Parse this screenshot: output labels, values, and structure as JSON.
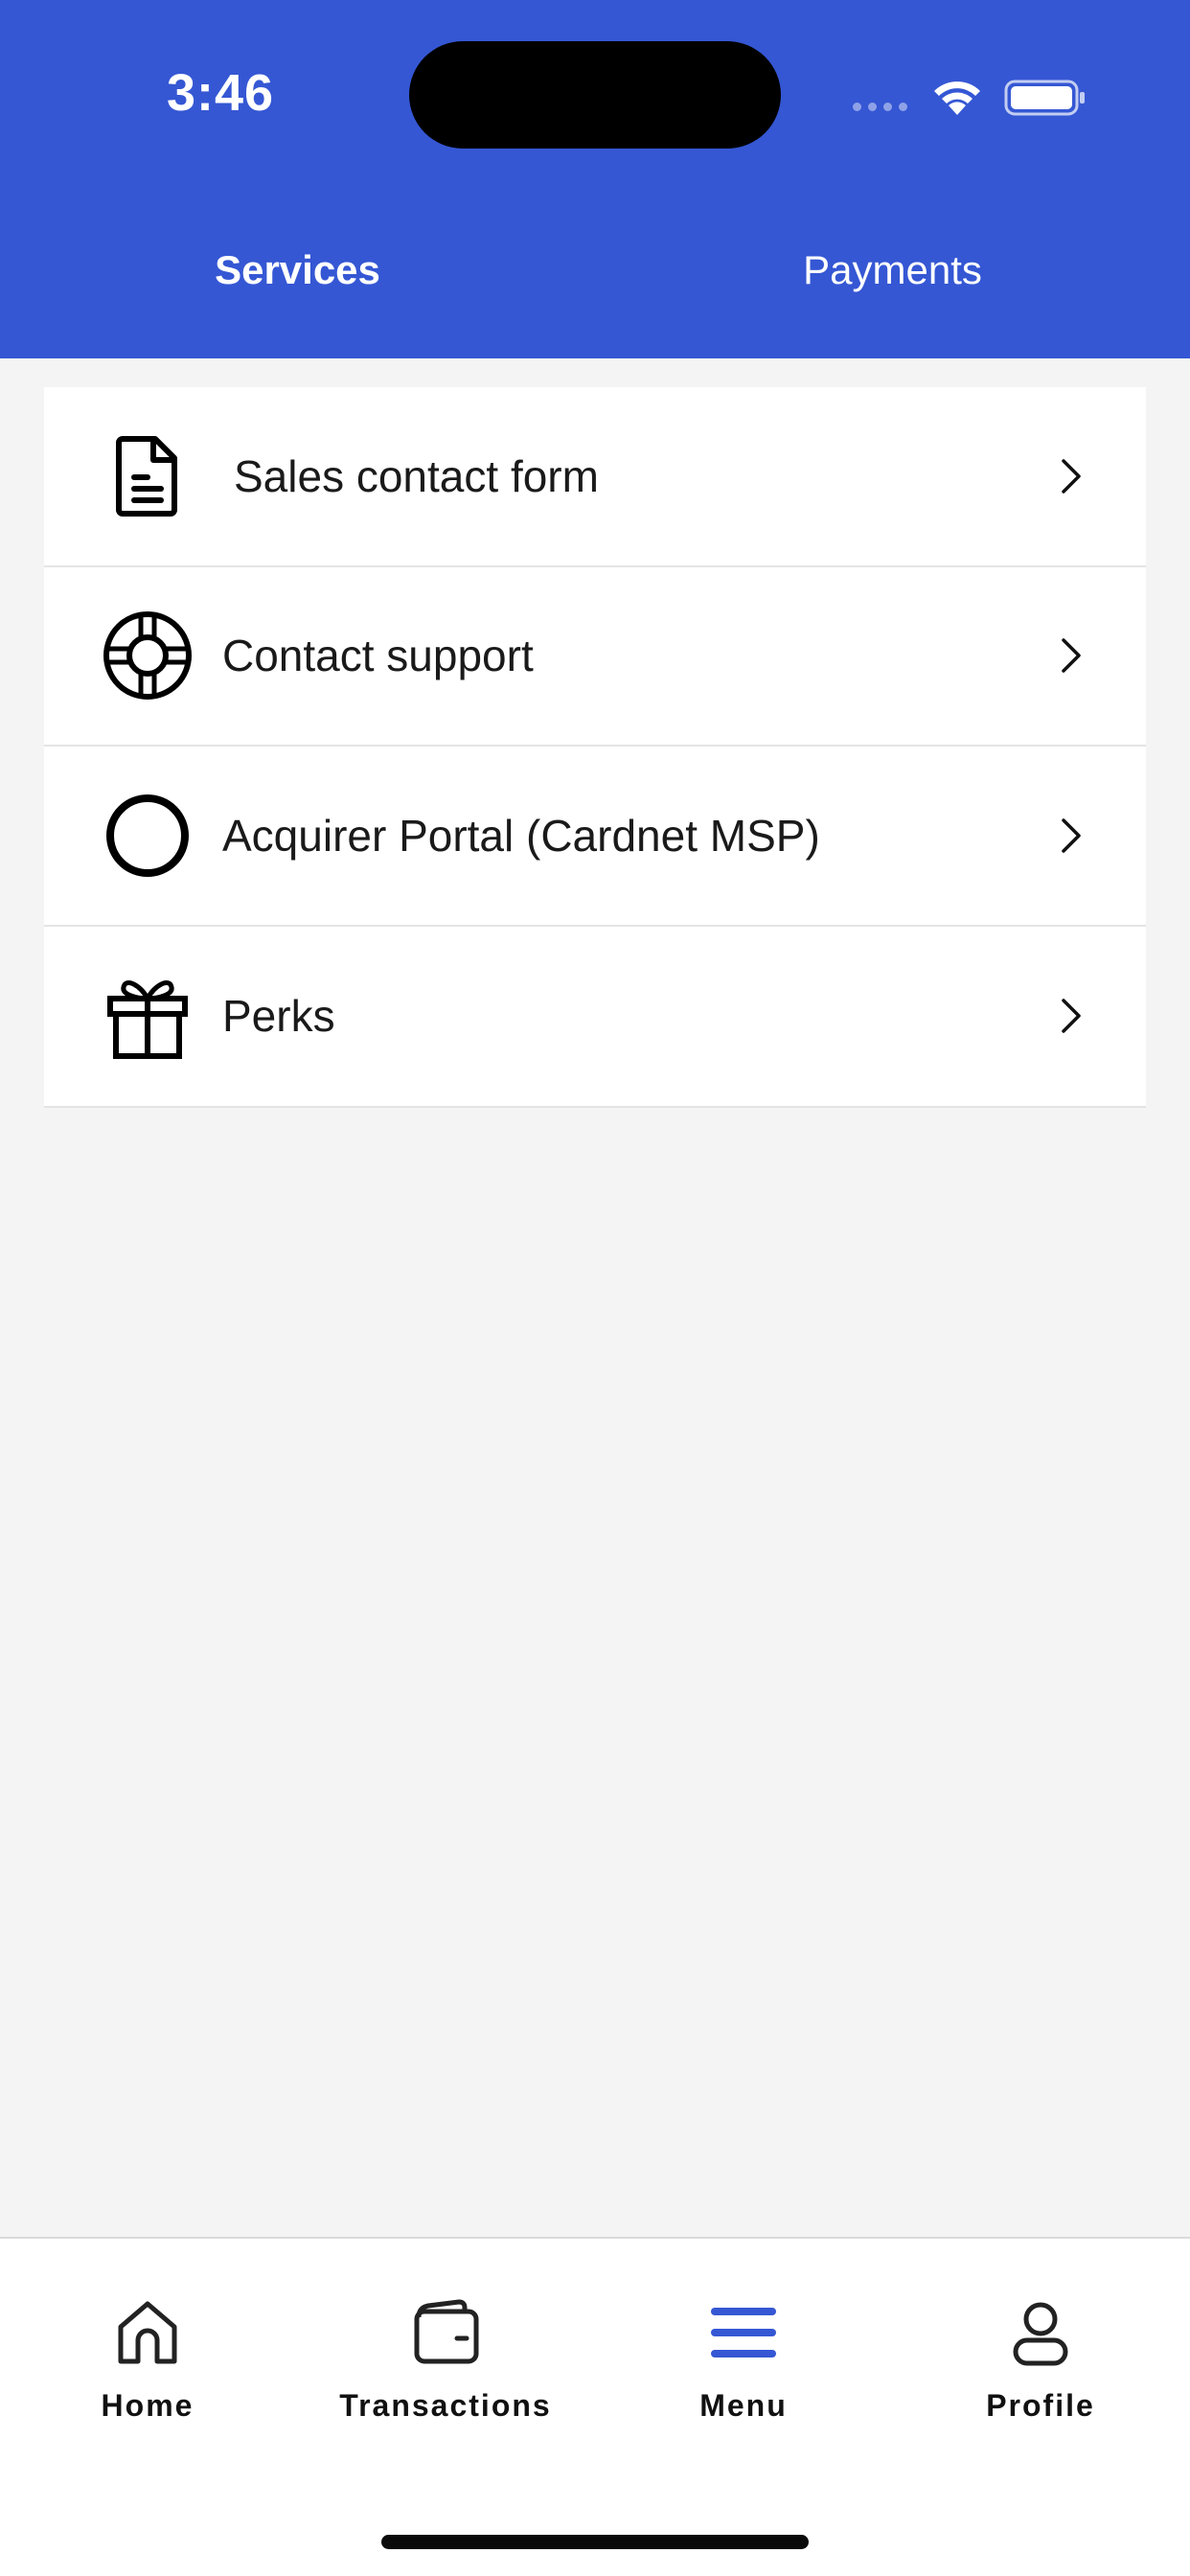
{
  "status_bar": {
    "time": "3:46"
  },
  "tabs": [
    {
      "label": "Services",
      "active": true
    },
    {
      "label": "Payments",
      "active": false
    }
  ],
  "menu_items": [
    {
      "label": "Sales contact form",
      "icon": "document-icon"
    },
    {
      "label": "Contact support",
      "icon": "lifebuoy-icon"
    },
    {
      "label": "Acquirer Portal (Cardnet MSP)",
      "icon": "circle-icon"
    },
    {
      "label": "Perks",
      "icon": "gift-icon"
    }
  ],
  "bottom_nav": [
    {
      "label": "Home",
      "icon": "home-icon",
      "active": false
    },
    {
      "label": "Transactions",
      "icon": "wallet-icon",
      "active": false
    },
    {
      "label": "Menu",
      "icon": "menu-icon",
      "active": true
    },
    {
      "label": "Profile",
      "icon": "profile-icon",
      "active": false
    }
  ],
  "colors": {
    "header_bg": "#3557d4",
    "active_nav": "#3557d4",
    "page_bg": "#f4f4f4"
  }
}
